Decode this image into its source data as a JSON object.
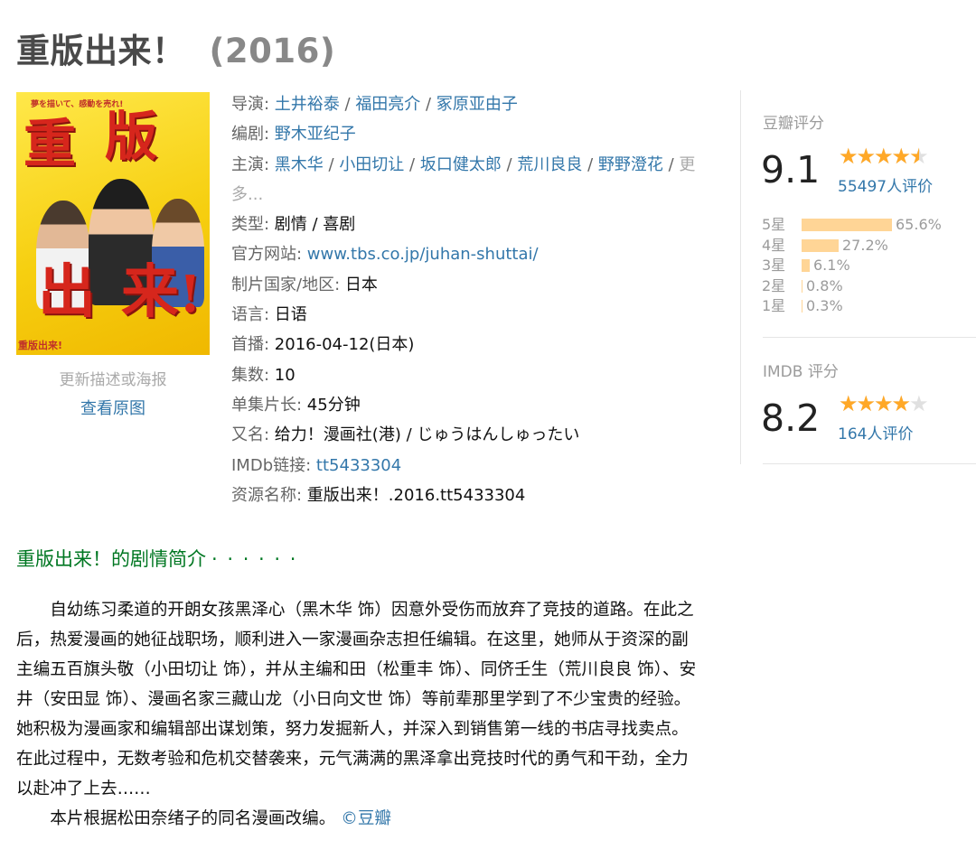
{
  "title": "重版出来！",
  "year": "(2016)",
  "poster": {
    "tagline": "夢を描いて、感動を売れ!",
    "big_chars": [
      "重",
      "版",
      "出",
      "来",
      "!"
    ],
    "foot": "重版出来!",
    "update_link": "更新描述或海报",
    "view_original": "查看原图"
  },
  "info": {
    "director_label": "导演",
    "directors": [
      "土井裕泰",
      "福田亮介",
      "冢原亚由子"
    ],
    "writer_label": "编剧",
    "writer": "野木亚纪子",
    "cast_label": "主演",
    "cast": [
      "黑木华",
      "小田切让",
      "坂口健太郎",
      "荒川良良",
      "野野澄花"
    ],
    "cast_more": "更多...",
    "genre_label": "类型",
    "genre": "剧情 / 喜剧",
    "website_label": "官方网站",
    "website": "www.tbs.co.jp/juhan-shuttai/",
    "country_label": "制片国家/地区",
    "country": "日本",
    "language_label": "语言",
    "language": "日语",
    "premiere_label": "首播",
    "premiere": "2016-04-12(日本)",
    "episodes_label": "集数",
    "episodes": "10",
    "runtime_label": "单集片长",
    "runtime": "45分钟",
    "aka_label": "又名",
    "aka": "给力！漫画社(港) / じゅうはんしゅったい",
    "imdb_label": "IMDb链接",
    "imdb": "tt5433304",
    "resource_label": "资源名称",
    "resource": "重版出来！.2016.tt5433304"
  },
  "douban": {
    "label": "豆瓣评分",
    "score": "9.1",
    "stars_fraction": 0.91,
    "votes": "55497人评价",
    "distribution": [
      {
        "label": "5星",
        "pct": "65.6%",
        "value": 65.6
      },
      {
        "label": "4星",
        "pct": "27.2%",
        "value": 27.2
      },
      {
        "label": "3星",
        "pct": "6.1%",
        "value": 6.1
      },
      {
        "label": "2星",
        "pct": "0.8%",
        "value": 0.8
      },
      {
        "label": "1星",
        "pct": "0.3%",
        "value": 0.3
      }
    ]
  },
  "imdb_rating": {
    "label": "IMDB 评分",
    "score": "8.2",
    "stars_fraction": 0.82,
    "votes": "164人评价"
  },
  "summary": {
    "heading": "重版出来！的剧情简介",
    "dots": "· · · · · ·",
    "paragraph1": "自幼练习柔道的开朗女孩黑泽心（黑木华 饰）因意外受伤而放弃了竞技的道路。在此之后，热爱漫画的她征战职场，顺利进入一家漫画杂志担任编辑。在这里，她师从于资深的副主编五百旗头敬（小田切让 饰），并从主编和田（松重丰 饰）、同侪壬生（荒川良良 饰）、安井（安田显 饰）、漫画名家三藏山龙（小日向文世 饰）等前辈那里学到了不少宝贵的经验。她积极为漫画家和编辑部出谋划策，努力发掘新人，并深入到销售第一线的书店寻找卖点。在此过程中，无数考验和危机交替袭来，元气满满的黑泽拿出竞技时代的勇气和干劲，全力以赴冲了上去……",
    "paragraph2": "本片根据松田奈绪子的同名漫画改编。",
    "credit": "©豆瓣"
  },
  "colors": {
    "link": "#3377aa",
    "star": "#ffa827",
    "bar": "#ffd596",
    "section": "#007722"
  }
}
